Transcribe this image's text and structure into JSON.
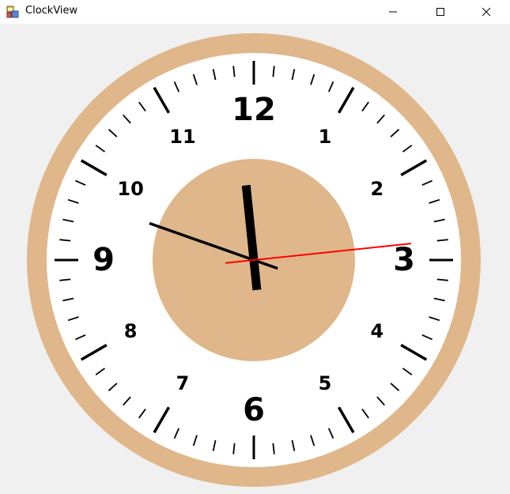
{
  "window": {
    "title": "ClockView",
    "icon": "app-window-icon",
    "controls": [
      "minimize-icon",
      "maximize-icon",
      "close-icon"
    ]
  },
  "clock": {
    "numerals": [
      "12",
      "1",
      "2",
      "3",
      "4",
      "5",
      "6",
      "7",
      "8",
      "9",
      "10",
      "11"
    ],
    "colors": {
      "rim": "#dfb78a",
      "face": "#ffffff",
      "center_disc": "#dfb78a",
      "ticks": "#000000",
      "hour_hand": "#000000",
      "minute_hand": "#000000",
      "second_hand": "#ff0000"
    },
    "time_shown": {
      "hour": 11,
      "minute": 48,
      "second": 14
    }
  }
}
